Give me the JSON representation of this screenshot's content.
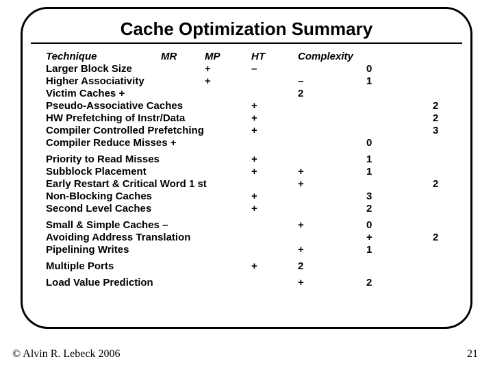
{
  "title": "Cache Optimization Summary",
  "header": {
    "tech": "Technique",
    "mr": "MR",
    "mp": "MP",
    "ht": "HT",
    "cx": "Complexity"
  },
  "rows": [
    {
      "tech": "Larger Block Size",
      "mp": "+",
      "ht": "–",
      "cxnum": "0"
    },
    {
      "tech": "Higher Associativity",
      "mp": "+",
      "cx": "–",
      "cxnum": "1"
    },
    {
      "tech": "Victim Caches    +",
      "cx": "2"
    },
    {
      "tech": "Pseudo-Associative Caches",
      "ht": "+",
      "cxnum2": "2"
    },
    {
      "tech": "HW Prefetching of Instr/Data",
      "ht": "+",
      "cxnum2": "2"
    },
    {
      "tech": "Compiler Controlled Prefetching",
      "ht": "+",
      "cxnum2": "3"
    },
    {
      "tech": "Compiler Reduce Misses +",
      "cxnum": "0"
    },
    {
      "gap": true
    },
    {
      "tech": "Priority to Read Misses",
      "ht": "+",
      "cxnum": "1"
    },
    {
      "tech": "Subblock Placement",
      "ht": "+",
      "cx": "+",
      "cxnum": "1"
    },
    {
      "tech": "Early Restart & Critical Word 1 st",
      "cx": "+",
      "cxnum2": "2"
    },
    {
      "tech": "Non-Blocking Caches",
      "ht": "+",
      "cxnum": "3"
    },
    {
      "tech": "Second Level  Caches",
      "ht": "+",
      "cxnum": "2"
    },
    {
      "gap": true
    },
    {
      "tech": "Small & Simple Caches    –",
      "cx": "+",
      "cxnum": "0"
    },
    {
      "tech": "Avoiding Address Translation",
      "cxnum": "+",
      "cxnum2": "2"
    },
    {
      "tech": "Pipelining Writes",
      "cx": "+",
      "cxnum": "1"
    },
    {
      "gap": true
    },
    {
      "tech": "Multiple Ports",
      "ht": "+",
      "cx": "2"
    },
    {
      "gap": true
    },
    {
      "tech": "Load Value Prediction",
      "cx": "+",
      "cxnum": "2"
    }
  ],
  "copyright": "© Alvin R. Lebeck 2006",
  "pagenum": "21"
}
